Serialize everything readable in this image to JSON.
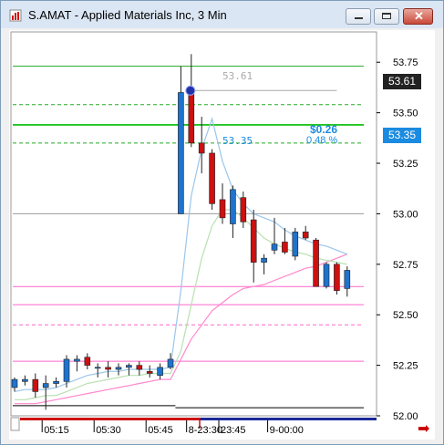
{
  "window": {
    "title": "S.AMAT - Applied Materials Inc, 3 Min"
  },
  "chart_data": {
    "type": "candlestick",
    "y_axis": {
      "range": [
        52.0,
        53.9
      ],
      "ticks": [
        "53.75",
        "53.50",
        "53.25",
        "53.00",
        "52.75",
        "52.50",
        "52.25",
        "52.00"
      ],
      "badges": [
        "53.61",
        "53.35"
      ]
    },
    "x_axis": {
      "ticks": [
        "05:15",
        "05:30",
        "05:45",
        "8-23:30",
        "23:45",
        "9-00:00"
      ]
    },
    "annotations": {
      "price_a": "53.61",
      "price_b": "53.35",
      "change": "$0.26",
      "change_pct": "0.48 %"
    },
    "colors": {
      "up": "#1f73cc",
      "down": "#cc1111",
      "grid": "#ffffff",
      "green_level": "#00bb00",
      "pink_level": "#ff66cc",
      "accent": "#1a8be0"
    },
    "candles": [
      {
        "t": "05:06",
        "o": 52.14,
        "h": 52.19,
        "l": 52.12,
        "c": 52.18
      },
      {
        "t": "05:09",
        "o": 52.17,
        "h": 52.2,
        "l": 52.15,
        "c": 52.18
      },
      {
        "t": "05:12",
        "o": 52.18,
        "h": 52.21,
        "l": 52.09,
        "c": 52.12
      },
      {
        "t": "05:15",
        "o": 52.14,
        "h": 52.2,
        "l": 52.03,
        "c": 52.16
      },
      {
        "t": "05:18",
        "o": 52.16,
        "h": 52.19,
        "l": 52.14,
        "c": 52.17
      },
      {
        "t": "05:21",
        "o": 52.17,
        "h": 52.3,
        "l": 52.14,
        "c": 52.28
      },
      {
        "t": "05:24",
        "o": 52.27,
        "h": 52.3,
        "l": 52.22,
        "c": 52.28
      },
      {
        "t": "05:27",
        "o": 52.29,
        "h": 52.31,
        "l": 52.23,
        "c": 52.25
      },
      {
        "t": "05:30",
        "o": 52.24,
        "h": 52.26,
        "l": 52.19,
        "c": 52.24
      },
      {
        "t": "05:33",
        "o": 52.24,
        "h": 52.27,
        "l": 52.19,
        "c": 52.23
      },
      {
        "t": "05:36",
        "o": 52.23,
        "h": 52.26,
        "l": 52.2,
        "c": 52.24
      },
      {
        "t": "05:39",
        "o": 52.24,
        "h": 52.26,
        "l": 52.2,
        "c": 52.25
      },
      {
        "t": "05:42",
        "o": 52.25,
        "h": 52.27,
        "l": 52.2,
        "c": 52.23
      },
      {
        "t": "05:45",
        "o": 52.22,
        "h": 52.25,
        "l": 52.19,
        "c": 52.21
      },
      {
        "t": "05:48",
        "o": 52.2,
        "h": 52.26,
        "l": 52.18,
        "c": 52.24
      },
      {
        "t": "05:51",
        "o": 52.24,
        "h": 52.31,
        "l": 52.23,
        "c": 52.28
      },
      {
        "t": "8-23:30",
        "o": 53.0,
        "h": 53.73,
        "l": 53.0,
        "c": 53.6
      },
      {
        "t": "23:33",
        "o": 53.61,
        "h": 53.79,
        "l": 53.33,
        "c": 53.35
      },
      {
        "t": "23:36",
        "o": 53.35,
        "h": 53.48,
        "l": 53.2,
        "c": 53.3
      },
      {
        "t": "23:39",
        "o": 53.3,
        "h": 53.32,
        "l": 53.02,
        "c": 53.05
      },
      {
        "t": "23:42",
        "o": 53.07,
        "h": 53.15,
        "l": 52.95,
        "c": 52.98
      },
      {
        "t": "23:45",
        "o": 52.95,
        "h": 53.14,
        "l": 52.88,
        "c": 53.12
      },
      {
        "t": "23:48",
        "o": 53.08,
        "h": 53.11,
        "l": 52.93,
        "c": 52.96
      },
      {
        "t": "23:51",
        "o": 52.97,
        "h": 53.02,
        "l": 52.66,
        "c": 52.76
      },
      {
        "t": "23:54",
        "o": 52.76,
        "h": 52.8,
        "l": 52.7,
        "c": 52.78
      },
      {
        "t": "23:57",
        "o": 52.82,
        "h": 52.98,
        "l": 52.8,
        "c": 52.85
      },
      {
        "t": "9-00:00",
        "o": 52.86,
        "h": 52.93,
        "l": 52.8,
        "c": 52.81
      },
      {
        "t": "00:03",
        "o": 52.79,
        "h": 52.93,
        "l": 52.77,
        "c": 52.91
      },
      {
        "t": "00:06",
        "o": 52.91,
        "h": 52.94,
        "l": 52.87,
        "c": 52.88
      },
      {
        "t": "00:09",
        "o": 52.87,
        "h": 52.88,
        "l": 52.64,
        "c": 52.64
      },
      {
        "t": "00:12",
        "o": 52.64,
        "h": 52.76,
        "l": 52.63,
        "c": 52.75
      },
      {
        "t": "00:15",
        "o": 52.75,
        "h": 52.76,
        "l": 52.6,
        "c": 52.62
      },
      {
        "t": "00:18",
        "o": 52.63,
        "h": 52.74,
        "l": 52.59,
        "c": 52.72
      }
    ],
    "ma_fast": [
      52.12,
      52.13,
      52.13,
      52.13,
      52.14,
      52.16,
      52.18,
      52.2,
      52.21,
      52.22,
      52.22,
      52.23,
      52.23,
      52.23,
      52.23,
      52.24,
      52.62,
      53.09,
      53.32,
      53.47,
      53.26,
      53.12,
      53.05,
      53.0,
      52.98,
      52.96,
      52.92,
      52.89,
      52.87,
      52.85,
      52.84,
      52.82,
      52.8
    ],
    "ma_mid": [
      52.08,
      52.08,
      52.09,
      52.1,
      52.1,
      52.12,
      52.14,
      52.16,
      52.17,
      52.18,
      52.19,
      52.2,
      52.2,
      52.21,
      52.21,
      52.21,
      52.32,
      52.55,
      52.78,
      52.94,
      53.02,
      53.02,
      52.98,
      52.93,
      52.88,
      52.85,
      52.83,
      52.81,
      52.8,
      52.78,
      52.77,
      52.76,
      52.75
    ],
    "ma_slow": [
      52.06,
      52.06,
      52.06,
      52.07,
      52.08,
      52.09,
      52.1,
      52.11,
      52.12,
      52.13,
      52.14,
      52.15,
      52.16,
      52.17,
      52.18,
      52.18,
      52.28,
      52.38,
      52.45,
      52.52,
      52.56,
      52.6,
      52.63,
      52.64,
      52.65,
      52.67,
      52.69,
      52.71,
      52.73,
      52.74,
      52.76,
      52.78,
      52.8
    ],
    "levels": [
      {
        "price": 53.73,
        "color": "#22aa22",
        "style": "solid"
      },
      {
        "price": 53.54,
        "color": "#22aa22",
        "style": "dash"
      },
      {
        "price": 53.44,
        "color": "#00bb00",
        "style": "solid"
      },
      {
        "price": 53.35,
        "color": "#22aa22",
        "style": "dash"
      },
      {
        "price": 53.0,
        "color": "#999999",
        "style": "solid"
      },
      {
        "price": 52.64,
        "color": "#ff66cc",
        "style": "solid"
      },
      {
        "price": 52.55,
        "color": "#ff66cc",
        "style": "solid"
      },
      {
        "price": 52.45,
        "color": "#ff66cc",
        "style": "dash"
      },
      {
        "price": 52.27,
        "color": "#ff66cc",
        "style": "solid"
      }
    ]
  }
}
